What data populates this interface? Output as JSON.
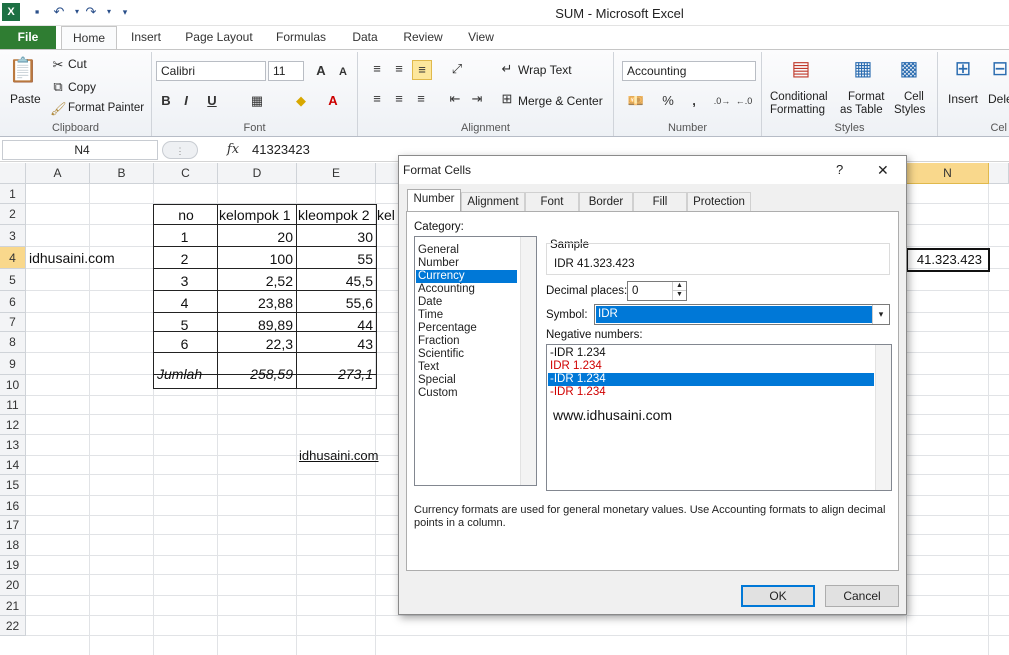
{
  "window": {
    "title": "SUM  -  Microsoft Excel"
  },
  "tabs": [
    {
      "label": "File"
    },
    {
      "label": "Home"
    },
    {
      "label": "Insert"
    },
    {
      "label": "Page Layout"
    },
    {
      "label": "Formulas"
    },
    {
      "label": "Data"
    },
    {
      "label": "Review"
    },
    {
      "label": "View"
    }
  ],
  "ribbon": {
    "clipboard": {
      "paste": "Paste",
      "cut": "Cut",
      "copy": "Copy",
      "format_painter": "Format Painter",
      "label": "Clipboard"
    },
    "font": {
      "name": "Calibri",
      "size": "11",
      "label": "Font",
      "bold": "B",
      "italic": "I",
      "underline": "U"
    },
    "alignment": {
      "wrap": "Wrap Text",
      "merge": "Merge & Center",
      "label": "Alignment"
    },
    "number": {
      "format": "Accounting",
      "percent": "%",
      "comma": ",",
      "label": "Number"
    },
    "styles": {
      "conditional": "Conditional",
      "conditional2": "Formatting",
      "format_table": "Format",
      "format_table2": "as Table",
      "cell_styles": "Cell",
      "cell_styles2": "Styles",
      "label": "Styles"
    },
    "cells": {
      "insert": "Insert",
      "delete": "Dele",
      "label": "Cel"
    }
  },
  "formula_bar": {
    "name_box": "N4",
    "fx": "fx",
    "value": "41323423"
  },
  "columns": [
    "A",
    "B",
    "C",
    "D",
    "E",
    "N"
  ],
  "rows": [
    "1",
    "2",
    "3",
    "4",
    "5",
    "6",
    "7",
    "8",
    "9",
    "10",
    "11",
    "12",
    "13",
    "14",
    "15",
    "16",
    "17",
    "18",
    "19",
    "20",
    "21",
    "22"
  ],
  "sheet": {
    "a4": "idhusaini.com",
    "c13": "idhusaini.com",
    "n4": "41.323.423",
    "headers": [
      "no",
      "kelompok 1",
      "kleompok 2",
      "kel"
    ],
    "table": [
      [
        "1",
        "20",
        "30"
      ],
      [
        "2",
        "100",
        "55"
      ],
      [
        "3",
        "2,52",
        "45,5"
      ],
      [
        "4",
        "23,88",
        "55,6"
      ],
      [
        "5",
        "89,89",
        "44"
      ],
      [
        "6",
        "22,3",
        "43"
      ]
    ],
    "total": [
      "Jumlah",
      "258,59",
      "273,1"
    ]
  },
  "dialog": {
    "title": "Format Cells",
    "help": "?",
    "close": "✕",
    "tabs": [
      "Number",
      "Alignment",
      "Font",
      "Border",
      "Fill",
      "Protection"
    ],
    "category_label": "Category:",
    "categories": [
      "General",
      "Number",
      "Currency",
      "Accounting",
      "Date",
      "Time",
      "Percentage",
      "Fraction",
      "Scientific",
      "Text",
      "Special",
      "Custom"
    ],
    "selected_category": "Currency",
    "sample_label": "Sample",
    "sample_value": "IDR 41.323.423",
    "decimal_label": "Decimal places:",
    "decimal_value": "0",
    "symbol_label": "Symbol:",
    "symbol_value": "IDR",
    "negative_label": "Negative numbers:",
    "negatives": [
      {
        "text": "-IDR 1.234",
        "color": "#111111"
      },
      {
        "text": "IDR 1.234",
        "color": "#d00000"
      },
      {
        "text": "-IDR 1.234",
        "color": "#ffffff"
      },
      {
        "text": "-IDR 1.234",
        "color": "#d00000"
      }
    ],
    "watermark": "www.idhusaini.com",
    "description": "Currency formats are used for general monetary values.  Use Accounting formats to align decimal points in a column.",
    "ok": "OK",
    "cancel": "Cancel"
  }
}
